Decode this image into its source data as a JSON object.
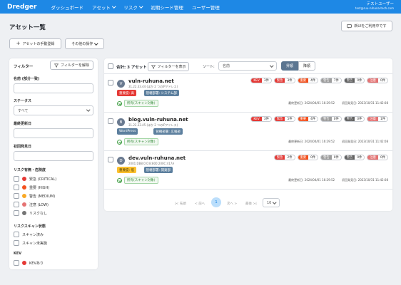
{
  "nav": {
    "brand": "Dredger",
    "items": [
      "ダッシュボード",
      "アセット",
      "リスク",
      "初期シード管理",
      "ユーザー管理"
    ],
    "user_name": "テストユーザー",
    "user_email": "test@ruu-ruhuna-tech.com"
  },
  "page": {
    "title": "アセット一覧",
    "feedback_button": "新UIをご利用中です",
    "manual_register_button": "アセットの手動登録",
    "other_ops_button": "その他の操作"
  },
  "filter": {
    "title": "フィルター",
    "clear_button": "フィルターを解除",
    "name_label": "名前 (部分一致)",
    "status_label": "ステータス",
    "status_value": "すべて",
    "last_updated_label": "最終更新日",
    "first_found_label": "初回発見日",
    "risk_label": "リスク有無・危険度",
    "risk_options": [
      {
        "label": "緊急 (CRITICAL)",
        "color": "#e53935"
      },
      {
        "label": "重要 (HIGH)",
        "color": "#f4511e"
      },
      {
        "label": "警告 (MEDIUM)",
        "color": "#f9a825"
      },
      {
        "label": "注意 (LOW)",
        "color": "#e57373"
      },
      {
        "label": "リスクなし",
        "color": "#757575"
      }
    ],
    "scan_label": "リスクスキャン状態",
    "scan_options": [
      "スキャン済み",
      "スキャン未実施"
    ],
    "kev_label": "KEV",
    "kev_option": "KEVあり",
    "kev_color": "#e53935"
  },
  "toolbar": {
    "total": "合計: 3 アセット",
    "filter_show": "フィルターを表示",
    "sort_label": "ソート:",
    "sort_value": "名前",
    "asc": "昇順",
    "desc": "降順"
  },
  "assets": [
    {
      "avatar": "V",
      "host": "vuln-ruhuna.net",
      "sub": "31.22.33.44 (ほか 2 つのIPアドレス)",
      "tags": [
        {
          "text": "重要度: 高",
          "color": "#e53935"
        },
        {
          "text": "管轄部署: システム部",
          "color": "#5c7f9e"
        }
      ],
      "scan_status": "所有(スキャン対象)",
      "kev": "KEV",
      "kev_count": "3件",
      "counts": [
        "3件",
        "4件",
        "7件",
        "0件",
        "0件"
      ],
      "last_updated": "最終更新日: 2024/04/01 16:29:52",
      "first_found": "初回発見日: 2023/10/31 11:42:08"
    },
    {
      "avatar": "B",
      "host": "blog.vuln-ruhuna.net",
      "sub": "31.22.33.45 (ほか 2 つのIPアドレス)",
      "tags": [
        {
          "text": "WordPress",
          "color": "#5c7f9e"
        },
        {
          "text": "管轄部署: 広報部",
          "color": "#5c7f9e"
        }
      ],
      "scan_status": "所有(スキャン対象)",
      "kev": "KEV",
      "kev_count": "3件",
      "counts": [
        "5件",
        "4件",
        "0件",
        "0件",
        "1件"
      ],
      "last_updated": "最終更新日: 2024/04/01 16:29:52",
      "first_found": "初回発見日: 2023/10/31 11:42:08"
    },
    {
      "avatar": "D",
      "host": "dev.vuln-ruhuna.net",
      "sub": "2001:DB8:0:0:8:800:200C:417A",
      "tags": [
        {
          "text": "重要度: 低",
          "color": "#fbc02d"
        },
        {
          "text": "管轄部署: 開発部",
          "color": "#5c7f9e"
        }
      ],
      "scan_status": "所有(スキャン対象)",
      "kev": "",
      "kev_count": "",
      "counts": [
        "2件",
        "0件",
        "0件",
        "0件",
        "0件"
      ],
      "last_updated": "最終更新日: 2024/04/01 16:29:52",
      "first_found": "初回発見日: 2023/10/31 11:42:08"
    }
  ],
  "severity": [
    {
      "label": "緊急",
      "color": "#e53935"
    },
    {
      "label": "重要",
      "color": "#f4511e"
    },
    {
      "label": "警告",
      "color": "#9e9e9e"
    },
    {
      "label": "警告",
      "color": "#616161"
    },
    {
      "label": "注意",
      "color": "#e57373"
    }
  ],
  "kev_color": "#e53935",
  "pagination": {
    "first": "|< 先頭",
    "prev": "< 前へ",
    "current": "1",
    "next": "次へ >",
    "last": "最後 >|",
    "page_size": "10"
  }
}
